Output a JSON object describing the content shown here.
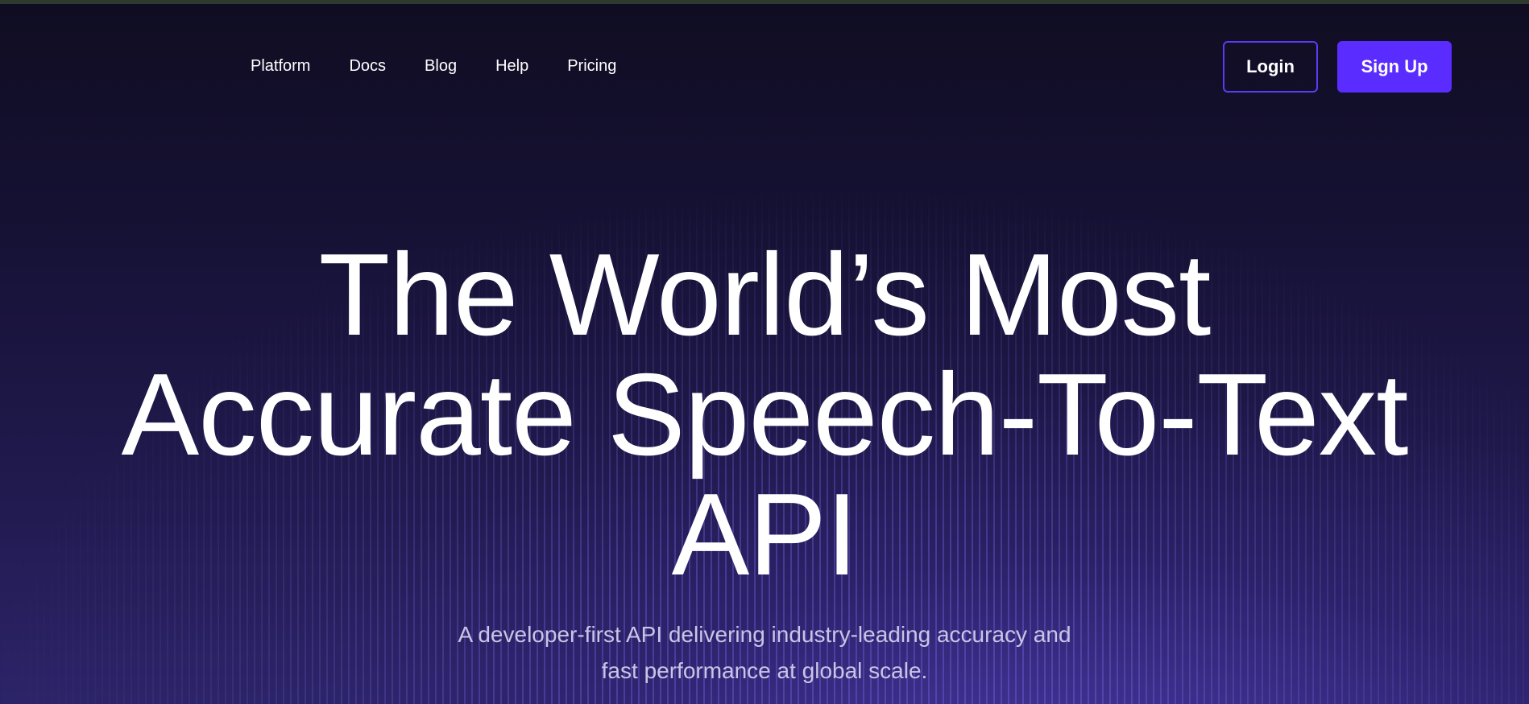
{
  "nav": {
    "links": [
      "Platform",
      "Docs",
      "Blog",
      "Help",
      "Pricing"
    ],
    "login_label": "Login",
    "signup_label": "Sign Up"
  },
  "hero": {
    "title_lines": [
      "The World’s Most",
      "Accurate Speech-To-Text",
      "API"
    ],
    "subtitle_lines": [
      "A developer-first API delivering industry-leading accuracy and",
      "fast performance at global scale."
    ]
  },
  "colors": {
    "accent": "#5b2cff",
    "background": "#100d22",
    "subtitle": "#c9c5e6"
  }
}
